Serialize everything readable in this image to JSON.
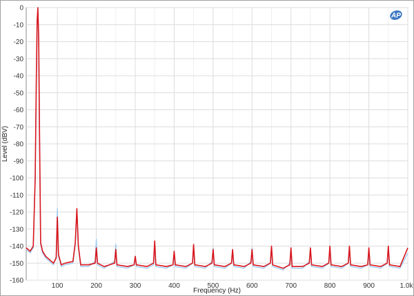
{
  "chart_data": {
    "type": "line",
    "xlabel": "Frequency (Hz)",
    "ylabel": "Level (dBV)",
    "xlim": [
      20,
      1000
    ],
    "ylim": [
      -160,
      0
    ],
    "x_ticks": [
      100,
      200,
      300,
      400,
      500,
      600,
      700,
      800,
      900,
      1000
    ],
    "x_tick_labels": [
      "100",
      "200",
      "300",
      "400",
      "500",
      "600",
      "700",
      "800",
      "900",
      "1.0k"
    ],
    "y_ticks": [
      0,
      -10,
      -20,
      -30,
      -40,
      -50,
      -60,
      -70,
      -80,
      -90,
      -100,
      -110,
      -120,
      -130,
      -140,
      -150,
      -160
    ],
    "y_tick_labels": [
      "0",
      "-10",
      "-20",
      "-30",
      "-40",
      "-50",
      "-60",
      "-70",
      "-80",
      "-90",
      "-100",
      "-110",
      "-120",
      "-130",
      "-140",
      "-150",
      "-160"
    ],
    "grid": true,
    "noise_floor": -152,
    "series": [
      {
        "color": "#d9151c",
        "x": [
          20,
          30,
          38,
          43,
          46,
          48,
          50,
          52,
          54,
          57,
          62,
          70,
          80,
          90,
          97,
          100,
          103,
          110,
          120,
          140,
          146,
          150,
          154,
          160,
          180,
          197,
          200,
          203,
          220,
          247,
          250,
          253,
          280,
          297,
          300,
          303,
          330,
          347,
          350,
          353,
          380,
          397,
          400,
          403,
          430,
          447,
          450,
          453,
          480,
          497,
          500,
          503,
          530,
          547,
          550,
          553,
          580,
          597,
          600,
          603,
          630,
          647,
          650,
          653,
          680,
          697,
          700,
          703,
          730,
          747,
          750,
          753,
          780,
          797,
          800,
          803,
          830,
          847,
          850,
          853,
          880,
          897,
          900,
          903,
          930,
          947,
          950,
          953,
          980,
          1000
        ],
        "y": [
          -141,
          -143,
          -140,
          -100,
          -40,
          -8,
          0,
          -18,
          -70,
          -138,
          -143,
          -146,
          -148,
          -150,
          -147,
          -123,
          -145,
          -151,
          -150,
          -149,
          -138,
          -118,
          -140,
          -151,
          -151,
          -150,
          -141,
          -150,
          -152,
          -150,
          -142,
          -151,
          -152,
          -151,
          -146,
          -151,
          -152,
          -150,
          -137,
          -151,
          -152,
          -151,
          -143,
          -151,
          -152,
          -150,
          -139,
          -151,
          -152,
          -150,
          -142,
          -151,
          -152,
          -150,
          -142,
          -151,
          -152,
          -150,
          -142,
          -151,
          -152,
          -150,
          -140,
          -151,
          -153,
          -151,
          -141,
          -152,
          -152,
          -150,
          -141,
          -151,
          -152,
          -150,
          -140,
          -151,
          -152,
          -150,
          -140,
          -151,
          -152,
          -151,
          -141,
          -151,
          -152,
          -150,
          -140,
          -151,
          -152,
          -141
        ]
      },
      {
        "color": "#9ccbf0",
        "x": [
          20,
          30,
          38,
          43,
          46,
          48,
          50,
          52,
          54,
          57,
          62,
          70,
          80,
          90,
          97,
          100,
          103,
          110,
          120,
          140,
          146,
          150,
          154,
          160,
          180,
          197,
          200,
          203,
          220,
          247,
          250,
          253,
          280,
          297,
          300,
          303,
          330,
          347,
          350,
          353,
          380,
          397,
          400,
          403,
          430,
          447,
          450,
          453,
          480,
          497,
          500,
          503,
          530,
          547,
          550,
          553,
          580,
          597,
          600,
          603,
          630,
          647,
          650,
          653,
          680,
          697,
          700,
          703,
          730,
          747,
          750,
          753,
          780,
          797,
          800,
          803,
          830,
          847,
          850,
          853,
          880,
          897,
          900,
          903,
          930,
          947,
          950,
          953,
          980,
          1000
        ],
        "y": [
          -142,
          -144,
          -141,
          -101,
          -41,
          -9,
          -1,
          -19,
          -71,
          -139,
          -144,
          -147,
          -149,
          -151,
          -146,
          -118,
          -146,
          -152,
          -151,
          -150,
          -139,
          -119,
          -141,
          -152,
          -152,
          -149,
          -136,
          -151,
          -153,
          -149,
          -139,
          -152,
          -153,
          -151,
          -146,
          -152,
          -153,
          -151,
          -139,
          -152,
          -153,
          -151,
          -145,
          -152,
          -153,
          -150,
          -142,
          -152,
          -153,
          -149,
          -141,
          -152,
          -153,
          -150,
          -144,
          -152,
          -153,
          -149,
          -141,
          -152,
          -153,
          -150,
          -143,
          -152,
          -154,
          -150,
          -144,
          -153,
          -153,
          -149,
          -142,
          -152,
          -153,
          -150,
          -142,
          -152,
          -153,
          -150,
          -143,
          -152,
          -153,
          -151,
          -145,
          -152,
          -153,
          -150,
          -142,
          -152,
          -153,
          -144
        ]
      }
    ]
  },
  "logo": {
    "text": "AP"
  }
}
